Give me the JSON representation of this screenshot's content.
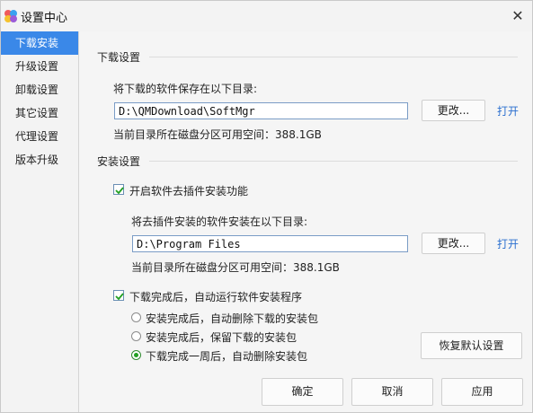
{
  "window": {
    "title": "设置中心"
  },
  "sidebar": {
    "items": [
      {
        "label": "下载安装",
        "active": true
      },
      {
        "label": "升级设置",
        "active": false
      },
      {
        "label": "卸载设置",
        "active": false
      },
      {
        "label": "其它设置",
        "active": false
      },
      {
        "label": "代理设置",
        "active": false
      },
      {
        "label": "版本升级",
        "active": false
      }
    ]
  },
  "download": {
    "section_title": "下载设置",
    "dir_label": "将下载的软件保存在以下目录:",
    "dir_value": "D:\\QMDownload\\SoftMgr",
    "change_label": "更改...",
    "open_label": "打开",
    "space_text": "当前目录所在磁盘分区可用空间：388.1GB"
  },
  "install": {
    "section_title": "安装设置",
    "plugin_checkbox_label": "开启软件去插件安装功能",
    "plugin_checked": true,
    "dir_label": "将去插件安装的软件安装在以下目录:",
    "dir_value": "D:\\Program Files",
    "change_label": "更改...",
    "open_label": "打开",
    "space_text": "当前目录所在磁盘分区可用空间：388.1GB",
    "auto_run_label": "下载完成后，自动运行软件安装程序",
    "auto_run_checked": true,
    "radio_options": [
      {
        "label": "安装完成后，自动删除下载的安装包",
        "checked": false
      },
      {
        "label": "安装完成后，保留下载的安装包",
        "checked": false
      },
      {
        "label": "下载完成一周后，自动删除安装包",
        "checked": true
      }
    ],
    "restore_default_label": "恢复默认设置"
  },
  "footer": {
    "ok_label": "确定",
    "cancel_label": "取消",
    "apply_label": "应用"
  },
  "colors": {
    "accent": "#3a88e8",
    "link": "#2b6fcf",
    "check": "#22a022"
  },
  "icons": {
    "app": "colorful-flower-icon",
    "close": "close-icon"
  }
}
